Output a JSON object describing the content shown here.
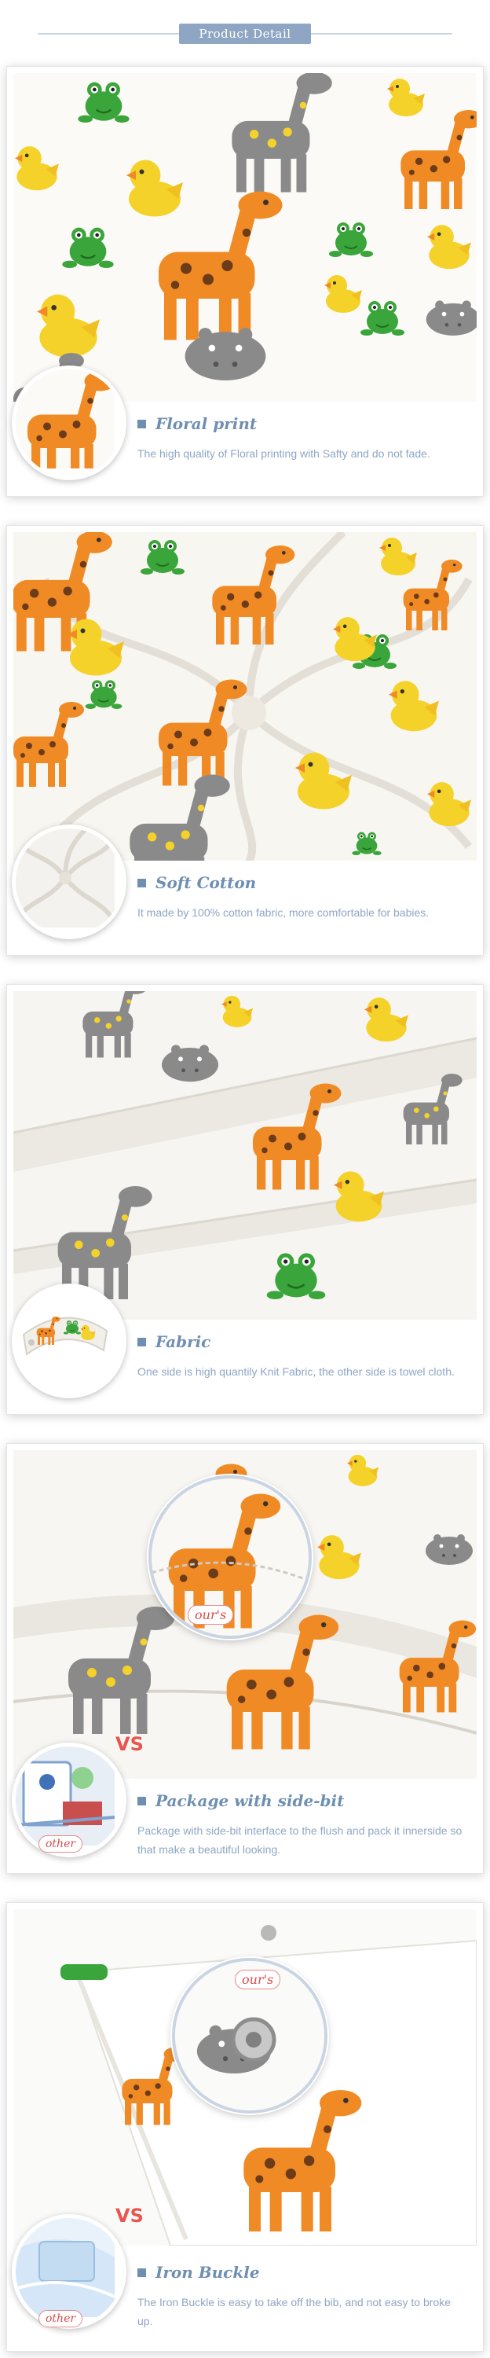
{
  "header": {
    "title": "Product Detail"
  },
  "sections": [
    {
      "title": "Floral print",
      "desc": "The high quality of Floral printing with Safty and do not fade."
    },
    {
      "title": "Soft Cotton",
      "desc": "It made by 100% cotton fabric, more comfortable for babies."
    },
    {
      "title": "Fabric",
      "desc": "One side is high quantily Knit Fabric, the other side is towel cloth."
    },
    {
      "title": "Package with side-bit",
      "desc": "Package with side-bit interface to the flush and pack it innerside so that make a beautiful looking.",
      "vs": "VS",
      "ours": "our's",
      "other": "other"
    },
    {
      "title": "Iron Buckle",
      "desc": "The Iron Buckle is easy to take off the bib, and not easy to broke up.",
      "vs": "VS",
      "ours": "our's",
      "other": "other"
    }
  ],
  "colors": {
    "accent": "#6f8fb2",
    "header_bg": "#8ea6c4",
    "vs": "#e8564f",
    "giraffe": "#f08a24",
    "duck": "#f5d22a",
    "frog": "#3aa53a",
    "hippo": "#808080"
  }
}
